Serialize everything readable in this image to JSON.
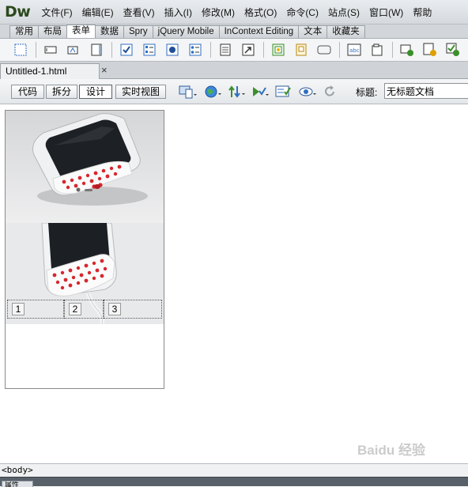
{
  "app": {
    "logo": "Dw"
  },
  "menu": {
    "items": [
      "文件(F)",
      "编辑(E)",
      "查看(V)",
      "插入(I)",
      "修改(M)",
      "格式(O)",
      "命令(C)",
      "站点(S)",
      "窗口(W)",
      "帮助"
    ]
  },
  "insert_panel": {
    "tabs": [
      "常用",
      "布局",
      "表单",
      "数据",
      "Spry",
      "jQuery Mobile",
      "InContext Editing",
      "文本",
      "收藏夹"
    ],
    "active_tab": "表单",
    "icons": [
      "form-icon",
      "text-field-icon",
      "hidden-field-icon",
      "textarea-icon",
      "checkbox-icon",
      "checkbox-group-icon",
      "radio-button-icon",
      "radio-group-icon",
      "select-list-icon",
      "jump-menu-icon",
      "image-field-icon",
      "file-field-icon",
      "button-icon",
      "label-icon",
      "fieldset-icon",
      "spry-text-field-icon",
      "spry-textarea-icon",
      "spry-checkbox-icon",
      "spry-select-icon",
      "spry-password-icon",
      "spry-confirm-icon"
    ]
  },
  "document": {
    "tab_label": "Untitled-1.html",
    "close_glyph": "×"
  },
  "doc_toolbar": {
    "code_label": "代码",
    "split_label": "拆分",
    "design_label": "设计",
    "live_view_label": "实时视图",
    "title_label": "标题:",
    "title_value": "无标题文档"
  },
  "design_view": {
    "cells": [
      "1",
      "2",
      "3"
    ]
  },
  "status_bar": {
    "tag": "<body>"
  },
  "bottom_panel": {
    "tab_label": "属性"
  },
  "watermark": {
    "text": "Baidu 经验"
  },
  "colors": {
    "logo": "#2c4a1e",
    "chrome": "#d5d9dd",
    "accent_green": "#3a8f2a",
    "accent_blue": "#2f6fc0"
  }
}
